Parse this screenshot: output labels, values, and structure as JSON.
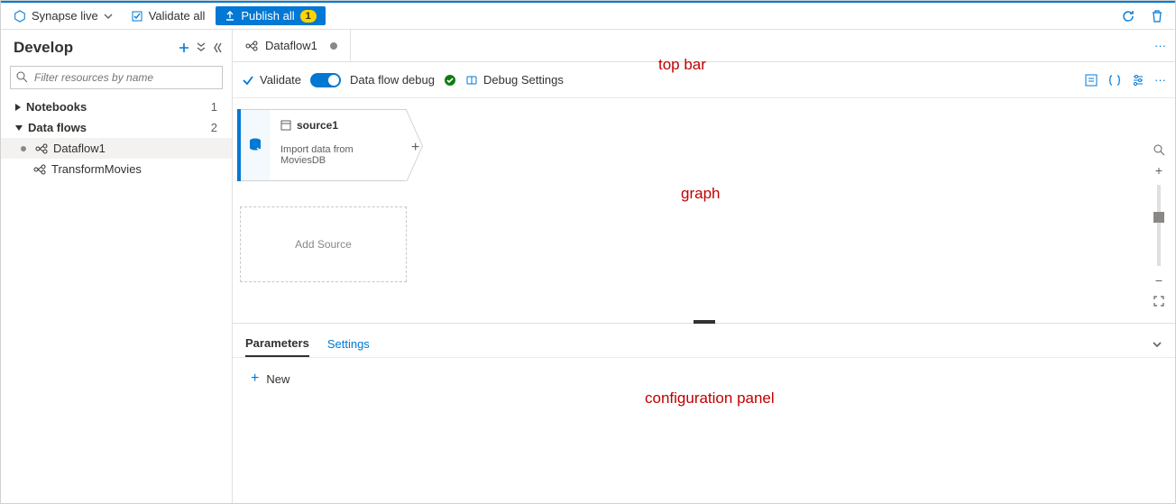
{
  "toolbar": {
    "workspace_label": "Synapse live",
    "validate_all_label": "Validate all",
    "publish_label": "Publish all",
    "publish_badge": "1"
  },
  "sidebar": {
    "title": "Develop",
    "search_placeholder": "Filter resources by name",
    "groups": [
      {
        "label": "Notebooks",
        "count": "1",
        "expanded": false
      },
      {
        "label": "Data flows",
        "count": "2",
        "expanded": true
      }
    ],
    "dataflow_items": [
      {
        "label": "Dataflow1",
        "selected": true,
        "dirty": true
      },
      {
        "label": "TransformMovies",
        "selected": false,
        "dirty": false
      }
    ]
  },
  "tab": {
    "label": "Dataflow1",
    "dirty": true
  },
  "action_bar": {
    "validate_label": "Validate",
    "debug_label": "Data flow debug",
    "debug_settings_label": "Debug Settings"
  },
  "graph": {
    "source_card": {
      "title": "source1",
      "description": "Import data from MoviesDB"
    },
    "add_source_label": "Add Source"
  },
  "config": {
    "tabs": {
      "parameters": "Parameters",
      "settings": "Settings"
    },
    "new_label": "New"
  },
  "annotations": {
    "topbar": "top bar",
    "graph": "graph",
    "config": "configuration panel"
  }
}
